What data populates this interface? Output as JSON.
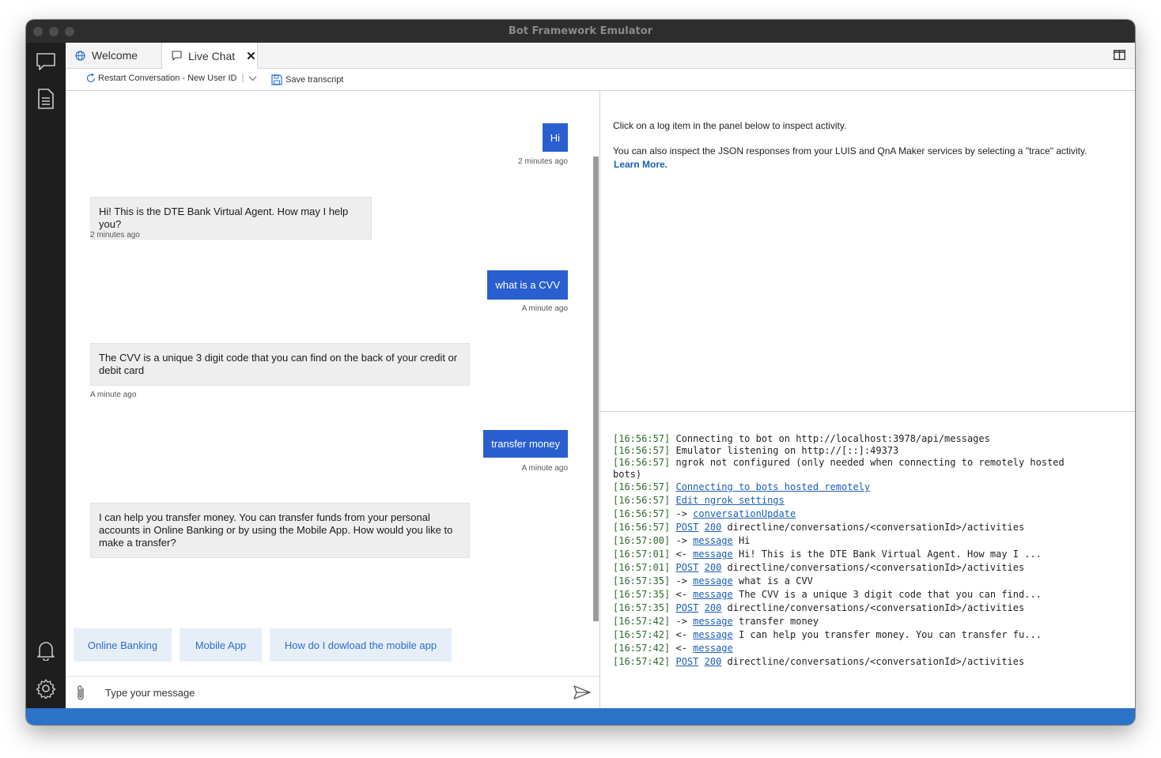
{
  "window": {
    "title": "Bot Framework Emulator"
  },
  "tabs": [
    {
      "label": "Welcome"
    },
    {
      "label": "Live Chat",
      "close": "✕"
    }
  ],
  "toolbar": {
    "restart_label": "Restart Conversation - New User ID",
    "save_label": "Save transcript"
  },
  "chat": {
    "messages": [
      {
        "from": "user",
        "text": "Hi",
        "time": "2 minutes ago"
      },
      {
        "from": "bot",
        "text": "Hi! This is the DTE Bank Virtual Agent. How may I help you?",
        "time": "2 minutes ago"
      },
      {
        "from": "user",
        "text": "what is a CVV",
        "time": "A minute ago"
      },
      {
        "from": "bot",
        "text": "The CVV is a unique 3 digit code that you can find on the back of your credit or debit card",
        "time": "A minute ago"
      },
      {
        "from": "user",
        "text": "transfer money",
        "time": "A minute ago"
      },
      {
        "from": "bot",
        "text": "I can help you transfer money. You can transfer funds from your personal accounts in Online Banking or by using the Mobile App. How would you like to make a transfer?",
        "time": ""
      }
    ],
    "suggestions": [
      "Online Banking",
      "Mobile App",
      "How do I dowload the mobile app"
    ],
    "input_placeholder": "Type your message"
  },
  "inspector": {
    "line1": "Click on a log item in the panel below to inspect activity.",
    "line2": "You can also inspect the JSON responses from your LUIS and QnA Maker services by selecting a \"trace\" activity.",
    "learn_more": "Learn More."
  },
  "log": [
    {
      "time": "[16:56:57]",
      "text": "Connecting to bot on http://localhost:3978/api/messages"
    },
    {
      "time": "[16:56:57]",
      "text": "Emulator listening on http://[::]:49373"
    },
    {
      "time": "[16:56:57]",
      "text": "ngrok not configured (only needed when connecting to remotely hosted"
    },
    {
      "time": "",
      "text": "bots)"
    },
    {
      "time": "[16:56:57]",
      "link": "Connecting to bots hosted remotely"
    },
    {
      "time": "[16:56:57]",
      "link": "Edit ngrok settings"
    },
    {
      "time": "[16:56:57]",
      "arrow": "->",
      "link": "conversationUpdate"
    },
    {
      "time": "[16:56:57]",
      "link": "POST",
      "link2": "200",
      "text": "directline/conversations/<conversationId>/activities"
    },
    {
      "time": "[16:57:00]",
      "arrow": "->",
      "link": "message",
      "text": "Hi"
    },
    {
      "time": "[16:57:01]",
      "arrow": "<-",
      "link": "message",
      "text": "Hi! This is the DTE Bank Virtual Agent. How may I ..."
    },
    {
      "time": "[16:57:01]",
      "link": "POST",
      "link2": "200",
      "text": "directline/conversations/<conversationId>/activities"
    },
    {
      "time": "[16:57:35]",
      "arrow": "->",
      "link": "message",
      "text": "what is a CVV"
    },
    {
      "time": "[16:57:35]",
      "arrow": "<-",
      "link": "message",
      "text": "The CVV is a unique 3 digit code that you can find..."
    },
    {
      "time": "[16:57:35]",
      "link": "POST",
      "link2": "200",
      "text": "directline/conversations/<conversationId>/activities"
    },
    {
      "time": "[16:57:42]",
      "arrow": "->",
      "link": "message",
      "text": "transfer money"
    },
    {
      "time": "[16:57:42]",
      "arrow": "<-",
      "link": "message",
      "text": "I can help you transfer money. You can transfer fu..."
    },
    {
      "time": "[16:57:42]",
      "arrow": "<-",
      "link": "message"
    },
    {
      "time": "[16:57:42]",
      "link": "POST",
      "link2": "200",
      "text": "directline/conversations/<conversationId>/activities"
    }
  ]
}
